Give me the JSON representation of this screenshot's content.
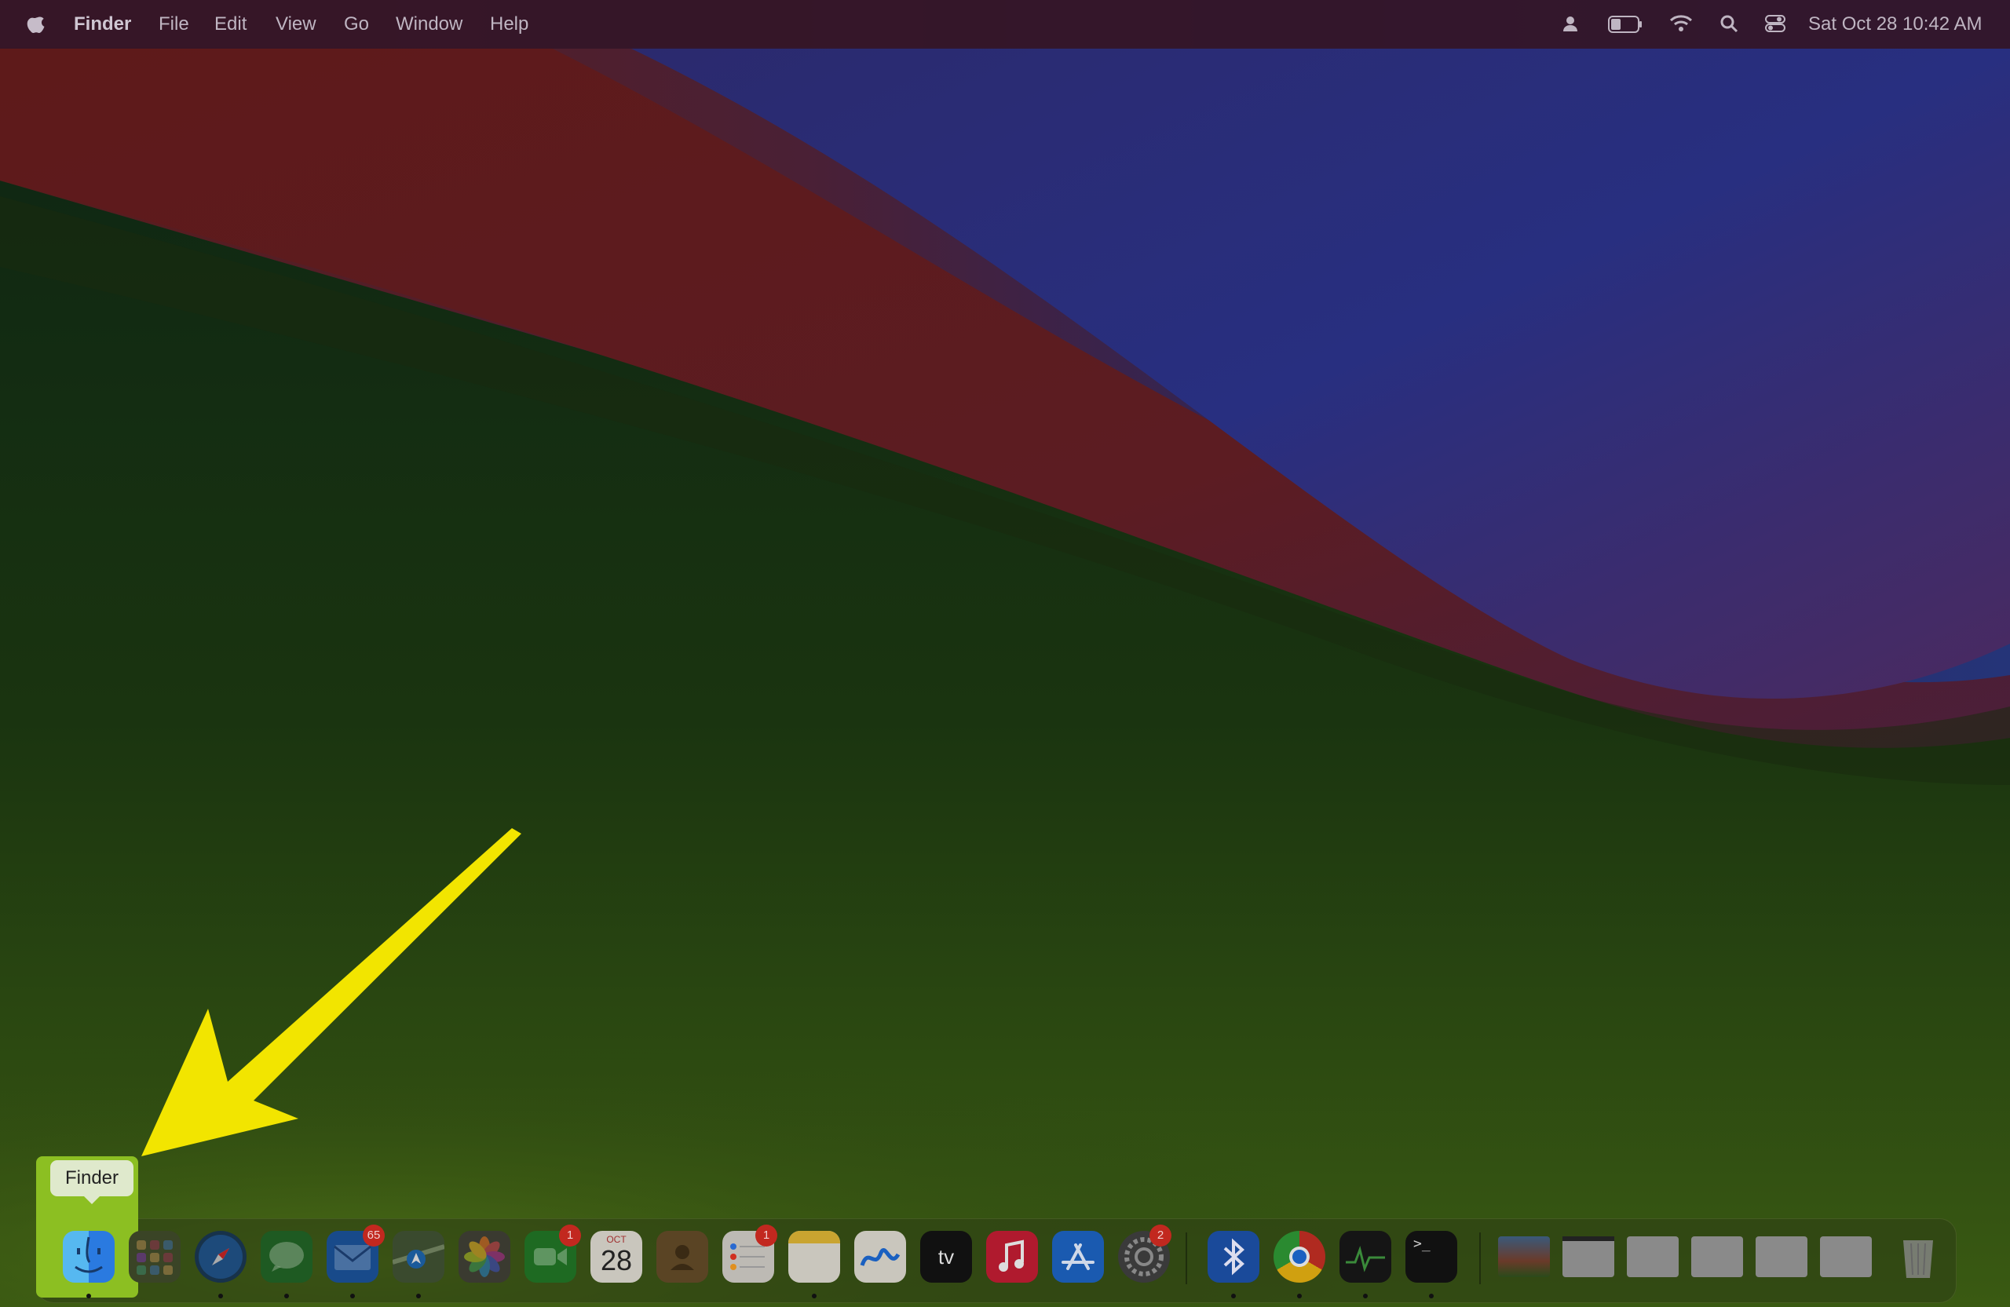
{
  "menubar": {
    "app_name": "Finder",
    "items": [
      "File",
      "Edit",
      "View",
      "Go",
      "Window",
      "Help"
    ],
    "status_icons": [
      "user-icon",
      "battery-icon",
      "wifi-icon",
      "spotlight-search-icon",
      "control-center-icon"
    ],
    "clock": "Sat Oct 28  10:42 AM"
  },
  "tooltip": {
    "label": "Finder"
  },
  "dock": {
    "apps": [
      {
        "name": "Finder",
        "icon": "finder-icon"
      },
      {
        "name": "Launchpad",
        "icon": "launchpad-icon"
      },
      {
        "name": "Safari",
        "icon": "safari-icon"
      },
      {
        "name": "Messages",
        "icon": "messages-icon"
      },
      {
        "name": "Mail",
        "icon": "mail-icon",
        "badge": "65"
      },
      {
        "name": "Maps",
        "icon": "maps-icon"
      },
      {
        "name": "Photos",
        "icon": "photos-icon"
      },
      {
        "name": "FaceTime",
        "icon": "facetime-icon",
        "badge": "1"
      },
      {
        "name": "Calendar",
        "icon": "calendar-icon",
        "month": "OCT",
        "day": "28"
      },
      {
        "name": "Contacts",
        "icon": "contacts-icon"
      },
      {
        "name": "Reminders",
        "icon": "reminders-icon",
        "badge": "1"
      },
      {
        "name": "Notes",
        "icon": "notes-icon"
      },
      {
        "name": "Freeform",
        "icon": "freeform-icon"
      },
      {
        "name": "TV",
        "icon": "appletv-icon",
        "label": "tv"
      },
      {
        "name": "Music",
        "icon": "music-icon"
      },
      {
        "name": "App Store",
        "icon": "appstore-icon"
      },
      {
        "name": "System Settings",
        "icon": "settings-icon",
        "badge": "2"
      },
      {
        "name": "Bluetooth",
        "icon": "bluetooth-icon"
      },
      {
        "name": "Chrome",
        "icon": "chrome-icon"
      },
      {
        "name": "Activity Monitor",
        "icon": "activity-monitor-icon"
      },
      {
        "name": "Terminal",
        "icon": "terminal-icon",
        "label": ">_"
      }
    ],
    "minimized": [
      "window-thumbnail-1",
      "window-thumbnail-2",
      "window-thumbnail-3",
      "window-thumbnail-4",
      "window-thumbnail-5",
      "window-thumbnail-6"
    ],
    "trash": {
      "icon": "trash-icon"
    }
  },
  "colors": {
    "arrow": "#f2e500",
    "highlight": "#8cbf22",
    "menubar": "#341628"
  }
}
